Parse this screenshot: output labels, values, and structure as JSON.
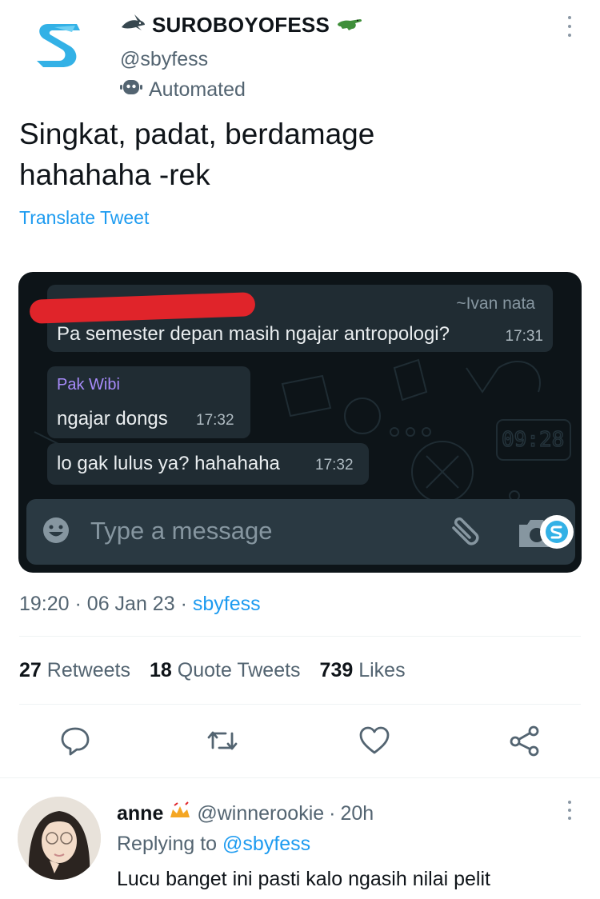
{
  "tweet": {
    "author_name": "SUROBOYOFESS",
    "author_handle": "@sbyfess",
    "automated_label": "Automated",
    "text_line1": "Singkat, padat, berdamage",
    "text_line2": "hahahaha -rek",
    "translate_label": "Translate Tweet",
    "time": "19:20",
    "date": "06 Jan 23",
    "via": "sbyfess",
    "separator": "·"
  },
  "chat": {
    "messages": [
      {
        "sender": "~Ivan nata",
        "text": "Pa semester depan masih ngajar antropologi?",
        "time": "17:31"
      },
      {
        "sender": "Pak Wibi",
        "text": "ngajar dongs",
        "time": "17:32"
      },
      {
        "sender": "",
        "text": "lo gak lulus ya? hahahaha",
        "time": "17:32"
      }
    ],
    "composer_placeholder": "Type a message",
    "doodle_clock": "09:28"
  },
  "stats": {
    "retweets_count": "27",
    "retweets_label": "Retweets",
    "quotes_count": "18",
    "quotes_label": "Quote Tweets",
    "likes_count": "739",
    "likes_label": "Likes"
  },
  "reply": {
    "name": "anne",
    "handle": "@winnerookie",
    "age": "20h",
    "separator": "·",
    "replying_prefix": "Replying to",
    "replying_to": "@sbyfess",
    "text": "Lucu banget ini pasti kalo ngasih nilai pelit"
  },
  "icons": {
    "logo": "sbyfess-logo-icon",
    "shark": "shark-icon",
    "crocodile": "crocodile-icon",
    "bot": "bot-icon",
    "more": "more-options-icon",
    "reply": "reply-icon",
    "retweet": "retweet-icon",
    "like": "heart-icon",
    "share": "share-icon"
  },
  "colors": {
    "link": "#1d9bf0",
    "muted": "#536471",
    "chat_bg": "#0d1418",
    "bubble": "#202c33",
    "redaction": "#e0242a"
  }
}
